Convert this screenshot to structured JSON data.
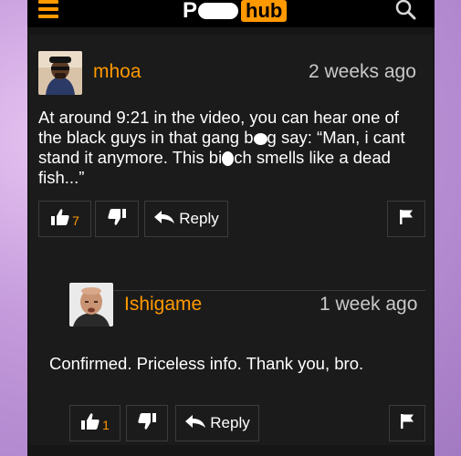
{
  "header": {
    "logo_left": "P",
    "logo_right": "hub"
  },
  "comments": [
    {
      "username": "mhoa",
      "timestamp": "2 weeks ago",
      "text_parts": [
        "At around 9:21 in the video, you can hear one of the black guys in that gang b",
        "g say: “Man, i cant stand it anymore. This bi",
        "ch smells like a dead fish...”"
      ],
      "likes": "7",
      "reply_label": "Reply"
    },
    {
      "username": "Ishigame",
      "timestamp": "1 week ago",
      "text": "Confirmed. Priceless info. Thank you, bro.",
      "likes": "1",
      "reply_label": "Reply"
    }
  ],
  "icons": {
    "menu": "hamburger-menu-icon",
    "search": "search-icon",
    "like": "thumbs-up-icon",
    "dislike": "thumbs-down-icon",
    "reply": "reply-arrow-icon",
    "flag": "flag-icon"
  },
  "colors": {
    "accent": "#ff9900",
    "background": "#161616",
    "card": "#1b1b1b",
    "text": "#ffffff",
    "muted": "#c9c9c9"
  }
}
